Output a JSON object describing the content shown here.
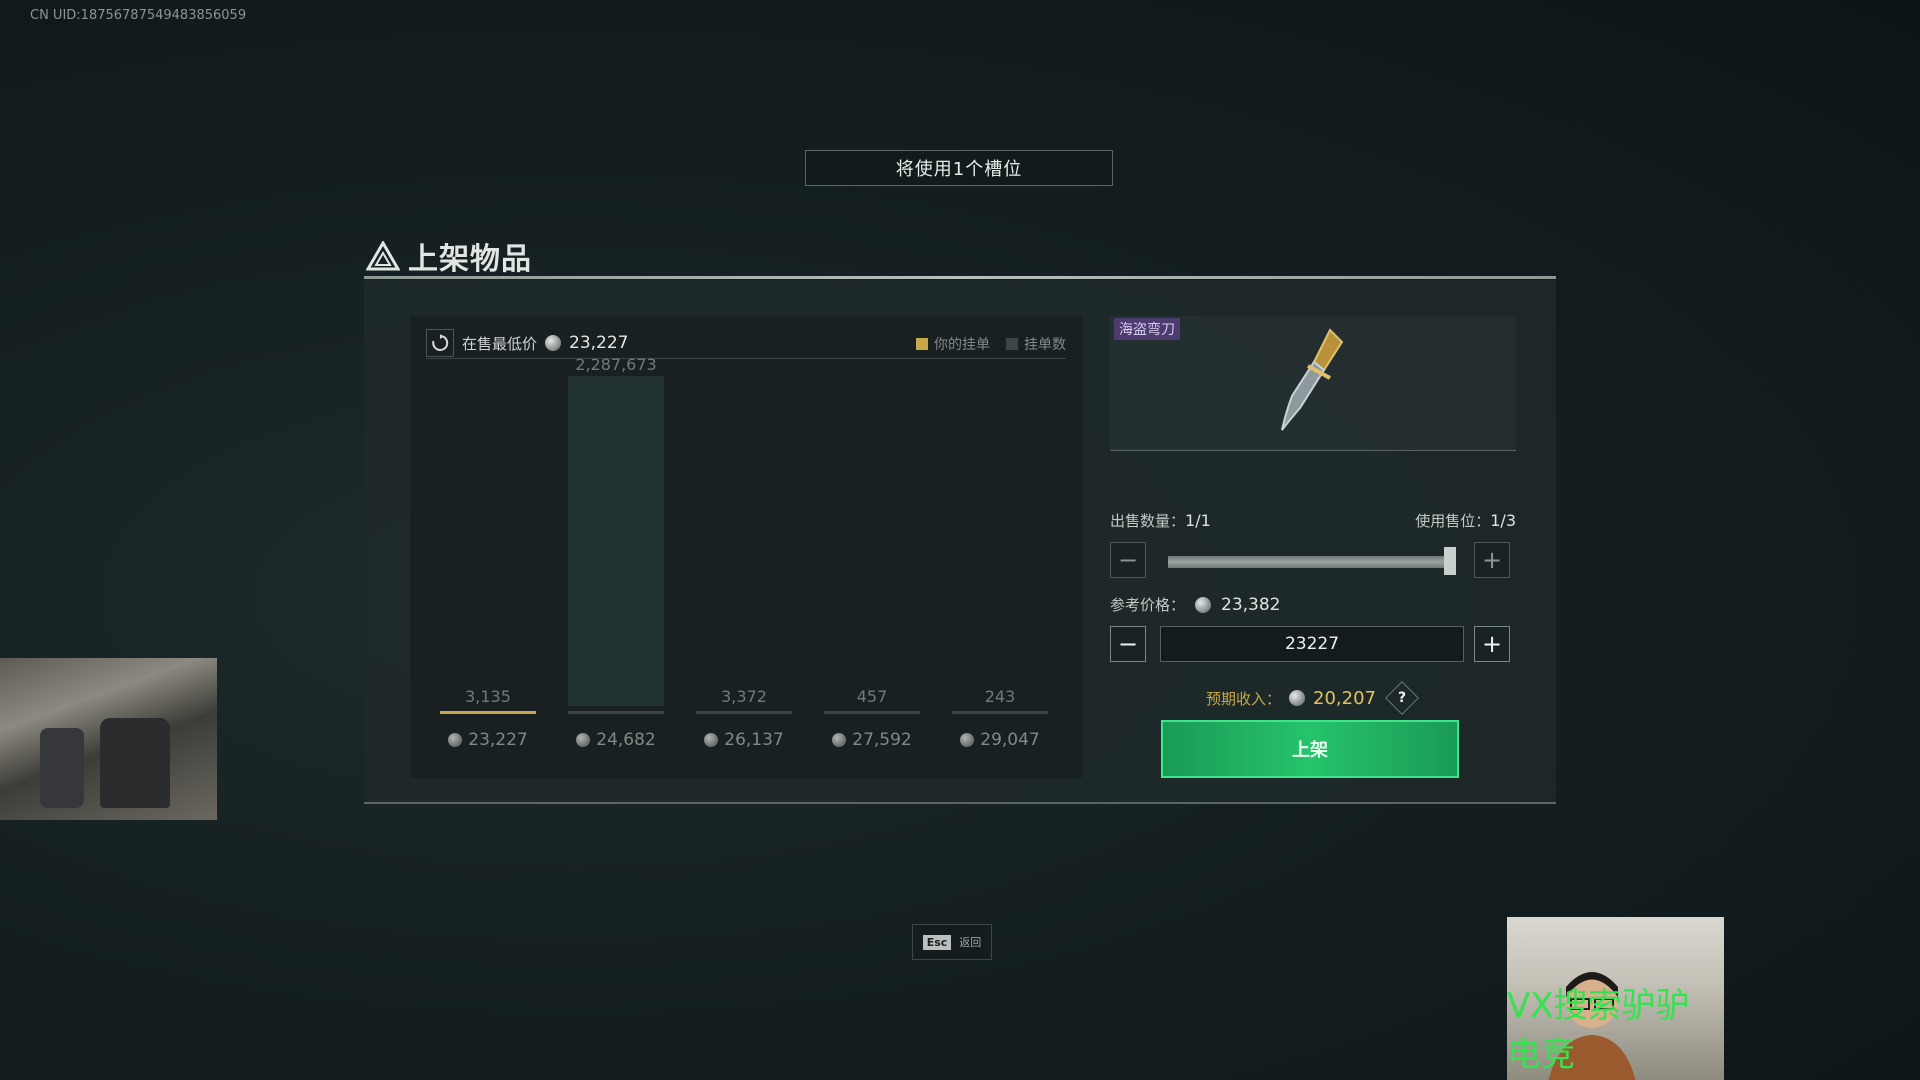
{
  "uid": "CN UID:18756787549483856059",
  "slot_banner": "将使用1个槽位",
  "dialog_title": "上架物品",
  "chart": {
    "lowest_label": "在售最低价",
    "lowest_price": "23,227",
    "legend_yours": "你的挂单",
    "legend_count": "挂单数"
  },
  "chart_data": {
    "type": "bar",
    "categories": [
      "23,227",
      "24,682",
      "26,137",
      "27,592",
      "29,047"
    ],
    "values": [
      3135,
      2287673,
      3372,
      457,
      243
    ],
    "value_labels": [
      "3,135",
      "2,287,673",
      "3,372",
      "457",
      "243"
    ],
    "series": [
      {
        "name": "挂单数",
        "values": [
          3135,
          2287673,
          3372,
          457,
          243
        ]
      }
    ],
    "highlight_index": 0,
    "title": "",
    "xlabel": "",
    "ylabel": ""
  },
  "item": {
    "name": "海盗弯刀"
  },
  "sell": {
    "qty_label": "出售数量：",
    "qty_value": "1/1",
    "slot_label": "使用售位：",
    "slot_value": "1/3",
    "slider_fraction": 1.0,
    "ref_label": "参考价格：",
    "ref_value": "23,382",
    "price_input": "23227",
    "income_label": "预期收入：",
    "income_value": "20,207",
    "help": "?",
    "list_button": "上架"
  },
  "esc": {
    "key": "Esc",
    "label": "返回"
  },
  "watermark": "VX搜索驴驴电竞",
  "colors": {
    "accent_green": "#26c36c",
    "gold": "#e3c15e",
    "tag_purple": "#4b3b6e"
  }
}
